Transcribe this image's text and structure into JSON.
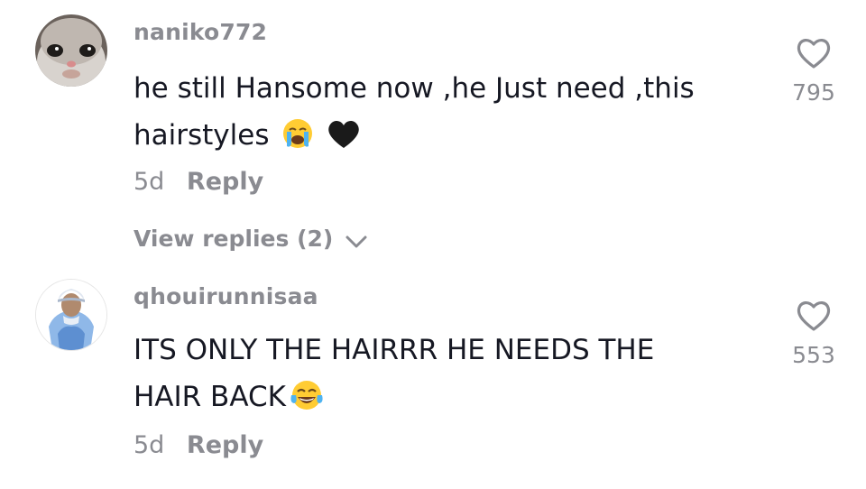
{
  "comments": [
    {
      "username": "naniko772",
      "text_line1": "he still Hansome now ,he Just need ,this",
      "text_line2": "hairstyles",
      "emoji": [
        "crying-face-emoji",
        "black-heart-emoji"
      ],
      "age": "5d",
      "reply_label": "Reply",
      "view_replies_label": "View replies (2)",
      "likes": "795"
    },
    {
      "username": "qhouirunnisaa",
      "text_line1": "ITS ONLY THE HAIRRR HE NEEDS THE",
      "text_line2": "HAIR BACK",
      "emoji": [
        "tears-of-joy-emoji"
      ],
      "age": "5d",
      "reply_label": "Reply",
      "likes": "553"
    }
  ],
  "colors": {
    "text": "#161823",
    "muted": "#8a8b91",
    "background": "#ffffff"
  }
}
